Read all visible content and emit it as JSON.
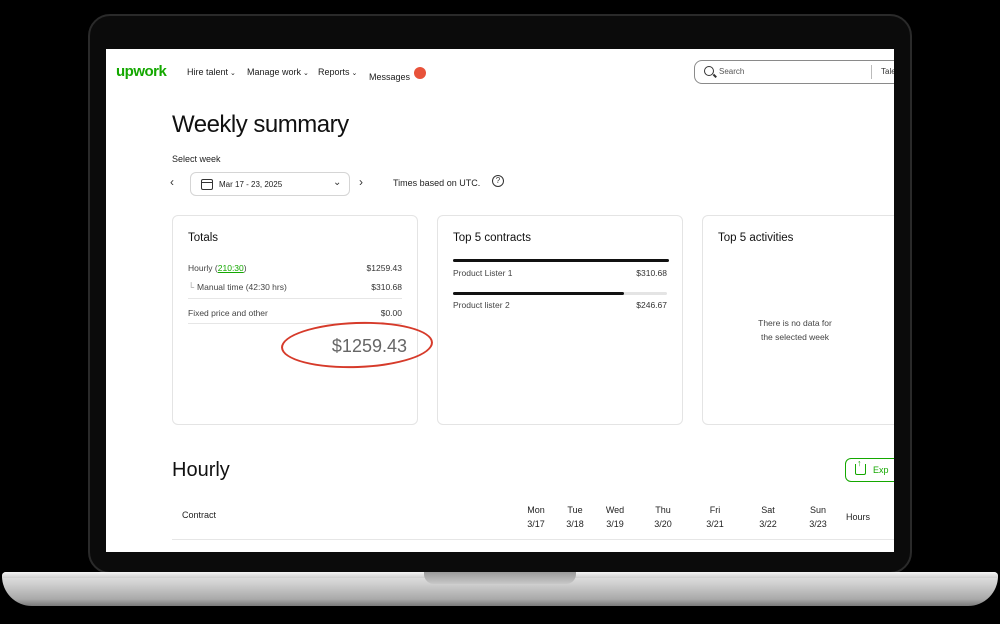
{
  "nav": {
    "logo": "upwork",
    "items": [
      "Hire talent",
      "Manage work",
      "Reports",
      "Messages"
    ],
    "messages_badge": "",
    "search_placeholder": "Search",
    "search_scope": "Tale"
  },
  "header": {
    "title": "Weekly summary",
    "select_week_label": "Select week",
    "week_range": "Mar 17 - 23, 2025",
    "timezone_note": "Times based on UTC.",
    "help": "?"
  },
  "totals": {
    "title": "Totals",
    "hourly_label": "Hourly (",
    "hourly_hours": "210:30",
    "hourly_close": ")",
    "hourly_value": "$1259.43",
    "manual_label": "Manual time (42:30 hrs)",
    "manual_value": "$310.68",
    "fixed_label": "Fixed price and other",
    "fixed_value": "$0.00",
    "grand_total": "$1259.43"
  },
  "contracts": {
    "title": "Top 5 contracts",
    "items": [
      {
        "name": "Product Lister 1",
        "amount": "$310.68",
        "share": 1.0
      },
      {
        "name": "Product lister 2",
        "amount": "$246.67",
        "share": 0.79
      }
    ]
  },
  "activities": {
    "title": "Top 5 activities",
    "empty_line1": "There is no data for",
    "empty_line2": "the selected week"
  },
  "hourly": {
    "title": "Hourly",
    "export_label": "Exp",
    "contract_header": "Contract",
    "days": [
      {
        "day": "Mon",
        "date": "3/17"
      },
      {
        "day": "Tue",
        "date": "3/18"
      },
      {
        "day": "Wed",
        "date": "3/19"
      },
      {
        "day": "Thu",
        "date": "3/20"
      },
      {
        "day": "Fri",
        "date": "3/21"
      },
      {
        "day": "Sat",
        "date": "3/22"
      },
      {
        "day": "Sun",
        "date": "3/23"
      }
    ],
    "hours_header": "Hours"
  },
  "colors": {
    "brand_green": "#14a800",
    "annotation_red": "#d63a2a",
    "badge": "#e8523a"
  }
}
